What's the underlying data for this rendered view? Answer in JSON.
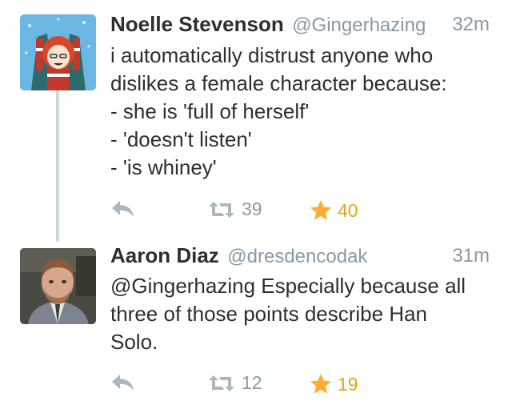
{
  "tweets": [
    {
      "author_name": "Noelle Stevenson",
      "handle": "@Gingerhazing",
      "time": "32m",
      "lines": [
        "i automatically distrust anyone who",
        "dislikes a female character because:",
        "- she is 'full of herself'",
        "- 'doesn't listen'",
        "- 'is whiney'"
      ],
      "retweets": "39",
      "favorites": "40"
    },
    {
      "author_name": "Aaron Diaz",
      "handle": "@dresdencodak",
      "time": "31m",
      "lines": [
        "@Gingerhazing Especially because all",
        "three of those points describe Han",
        "Solo."
      ],
      "retweets": "12",
      "favorites": "19"
    }
  ],
  "icons": {
    "reply": "reply-icon",
    "retweet": "retweet-icon",
    "favorite": "star-icon"
  },
  "colors": {
    "text": "#292f33",
    "muted": "#8899a6",
    "icon_gray": "#aab8c2",
    "favorite_gold": "#ffac33",
    "thread_line": "#ccd6dd"
  }
}
